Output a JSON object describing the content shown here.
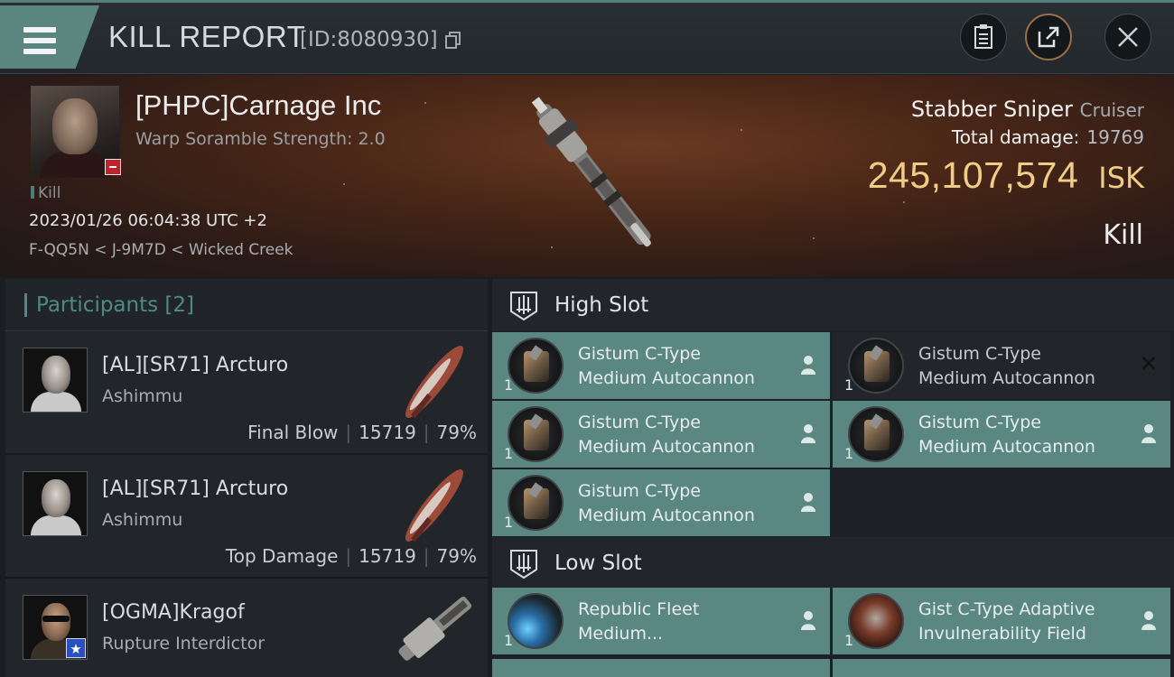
{
  "header": {
    "title": "KILL REPORT",
    "report_id": "[ID:8080930]",
    "icons": [
      "menu-icon",
      "copy-icon",
      "clipboard-icon",
      "share-icon",
      "close-icon"
    ]
  },
  "victim": {
    "name": "[PHPC]Carnage Inc",
    "detail": "Warp Soramble Strength: 2.0",
    "tag": "Kill",
    "datetime": "2023/01/26 06:04:38 UTC +2",
    "location": "F-QQ5N < J-9M7D < Wicked Creek"
  },
  "ship": {
    "name": "Stabber Sniper",
    "class": "Cruiser",
    "total_damage_label": "Total damage:",
    "total_damage": "19769",
    "isk_value": "245,107,574",
    "isk_unit": "ISK",
    "outcome": "Kill"
  },
  "participants": {
    "label": "Participants [2]",
    "items": [
      {
        "name": "[AL][SR71] Arcturo",
        "ship": "Ashimmu",
        "role": "Final Blow",
        "damage": "15719",
        "percent": "79%"
      },
      {
        "name": "[AL][SR71] Arcturo",
        "ship": "Ashimmu",
        "role": "Top Damage",
        "damage": "15719",
        "percent": "79%"
      },
      {
        "name": "[OGMA]Kragof",
        "ship": "Rupture Interdictor"
      }
    ]
  },
  "fitting": {
    "high_slot_label": "High Slot",
    "low_slot_label": "Low Slot",
    "high": [
      {
        "line1": "Gistum C-Type",
        "line2": "Medium Autocannon",
        "qty": "1"
      },
      {
        "line1": "Gistum C-Type",
        "line2": "Medium Autocannon",
        "qty": "1"
      },
      {
        "line1": "Gistum C-Type",
        "line2": "Medium Autocannon",
        "qty": "1"
      },
      {
        "line1": "Gistum C-Type",
        "line2": "Medium Autocannon",
        "qty": "1"
      },
      {
        "line1": "Gistum C-Type",
        "line2": "Medium Autocannon",
        "qty": "1"
      }
    ],
    "low": [
      {
        "line1": "Republic Fleet",
        "line2": "Medium...",
        "qty": "1"
      },
      {
        "line1": "Gist C-Type Adaptive",
        "line2": "Invulnerability Field",
        "qty": "1"
      }
    ]
  },
  "colors": {
    "accent": "#5a8781",
    "isk": "#f1cc86",
    "panel": "#22262a",
    "badge_red": "#c0242a"
  }
}
